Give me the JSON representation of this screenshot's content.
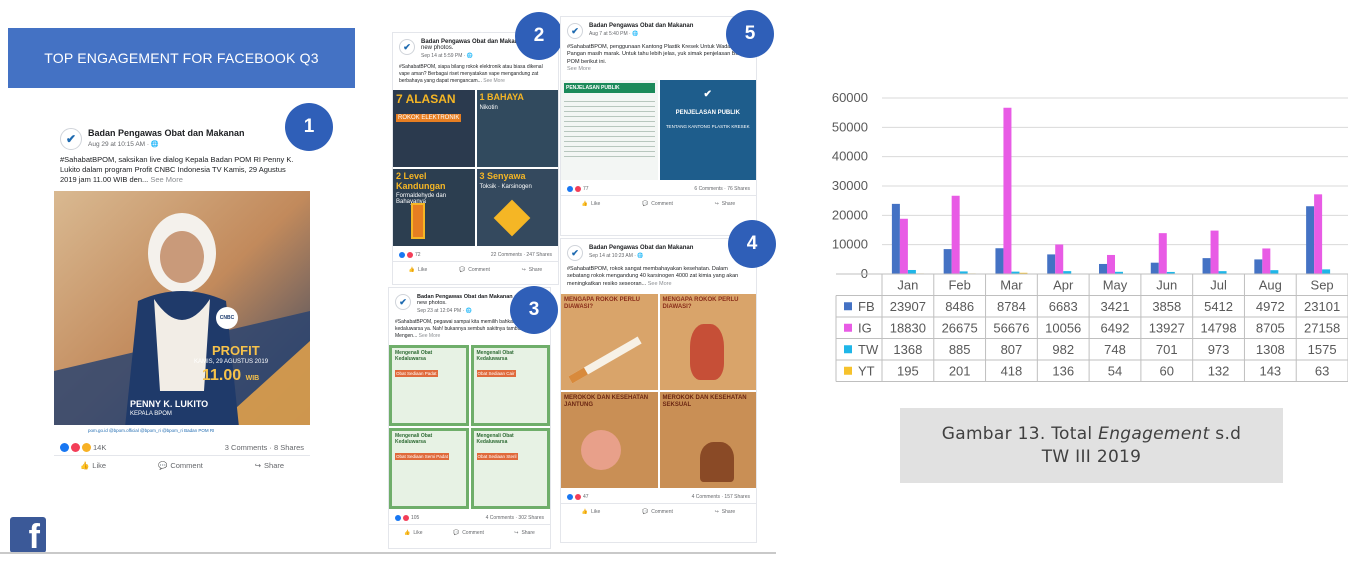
{
  "slide": {
    "title": "TOP ENGAGEMENT FOR FACEBOOK Q3",
    "badges": [
      "1",
      "2",
      "3",
      "4",
      "5"
    ],
    "logo_icon": "facebook-logo",
    "post1": {
      "page_name": "Badan Pengawas Obat dan Makanan",
      "time": "Aug 29 at 10:15 AM · ",
      "body": "#SahabatBPOM, saksikan live dialog Kepala Badan POM RI Penny K. Lukito dalam program Profit CNBC Indonesia TV Kamis, 29 Agustus 2019 jam 11.00 WIB den... ",
      "see_more": "See More",
      "image_title": "PROFIT",
      "image_date": "KAMIS, 29 AGUSTUS 2019",
      "image_time": "11.00",
      "image_time_suffix": "WIB",
      "image_name": "PENNY K. LUKITO",
      "image_role": "KEPALA BPOM",
      "image_channel": "CNBC",
      "image_footer": "pom.go.id   @bpom.official   @bpom_ri   @bpom_ri   Badan POM RI",
      "reaction_count": "14K",
      "stats": "3 Comments · 8 Shares",
      "actions": [
        "Like",
        "Comment",
        "Share"
      ]
    },
    "post2": {
      "page_name": "Badan Pengawas Obat dan Makanan",
      "page_suffix": "added 4 new photos.",
      "time": "Sep 14 at 5:59 PM · ",
      "body": "#SahabatBPOM, siapa bilang rokok elektronik atau biasa dikenal vape aman? Berbagai riset menyatakan vape mengandung zat berbahaya yang dapat mengancam... ",
      "see_more": "See More",
      "tiles": [
        {
          "title": "7 ALASAN",
          "sub": "ROKOK ELEKTRONIK"
        },
        {
          "title": "1 BAHAYA",
          "sub": "Nikotin"
        },
        {
          "title": "2 Level Kandungan",
          "sub": "Formaldehyde dan Bahayanya"
        },
        {
          "title": "3 Senyawa",
          "sub": "Toksik · Karsinogen"
        }
      ],
      "reaction_count": "72",
      "stats": "22 Comments · 247 Shares",
      "actions": [
        "Like",
        "Comment",
        "Share"
      ]
    },
    "post3": {
      "page_name": "Badan Pengawas Obat dan Makanan",
      "page_suffix": "added 4 new photos.",
      "time": "Sep 23 at 12:04 PM · ",
      "body": "#SahabatBPOM, pegawai sampai kita memilih bahkan obat kedaluwarsa ya. Nah! bukannya sembuh sakitnya tambah parah. ",
      "body_tail": "Mengen... ",
      "see_more": "See More",
      "tiles": [
        {
          "title": "Mengenali Obat Kedaluwarsa",
          "sub": "Obat Sediaan Padat"
        },
        {
          "title": "Mengenali Obat Kedaluwarsa",
          "sub": "Obat Sediaan Cair"
        },
        {
          "title": "Mengenali Obat Kedaluwarsa",
          "sub": "Obat Sediaan Semi Padat"
        },
        {
          "title": "Mengenali Obat Kedaluwarsa",
          "sub": "Obat Sediaan Steril"
        }
      ],
      "reaction_count": "105",
      "stats": "4 Comments · 302 Shares",
      "actions": [
        "Like",
        "Comment",
        "Share"
      ]
    },
    "post4": {
      "page_name": "Badan Pengawas Obat dan Makanan",
      "time": "Sep 14 at 10:23 AM · ",
      "body": "#SahabatBPOM, rokok sangat membahayakan kesehatan. Dalam sebatang rokok mengandung 40 karsinogen 4000 zat kimia yang akan meningkatkan resiko seseoran... ",
      "see_more": "See More",
      "tiles": [
        {
          "title": "MENGAPA ROKOK PERLU DIAWASI?",
          "sub": ""
        },
        {
          "title": "MENGAPA ROKOK PERLU DIAWASI?",
          "sub": ""
        },
        {
          "title": "MEROKOK DAN KESEHATAN JANTUNG",
          "sub": ""
        },
        {
          "title": "MEROKOK DAN KESEHATAN SEKSUAL",
          "sub": ""
        }
      ],
      "reaction_count": "47",
      "stats": "4 Comments · 157 Shares",
      "actions": [
        "Like",
        "Comment",
        "Share"
      ]
    },
    "post5": {
      "page_name": "Badan Pengawas Obat dan Makanan",
      "time": "Aug 7 at 5:40 PM · ",
      "body": "#SahabatBPOM, penggunaan Kantong Plastik Kresek Untuk Wadah Pangan masih marak. Untuk tahu lebih jelas, yuk simak penjelasan Badan POM berikut ini.",
      "see_more": "See More",
      "tiles": [
        {
          "title": "PENJELASAN PUBLIK",
          "sub": ""
        },
        {
          "title": "PENJELASAN PUBLIK",
          "sub": "TENTANG KANTONG PLASTIK KRESEK"
        }
      ],
      "reaction_count": "77",
      "stats": "6 Comments · 76 Shares",
      "actions": [
        "Like",
        "Comment",
        "Share"
      ]
    }
  },
  "chart_data": {
    "type": "bar",
    "categories": [
      "Jan",
      "Feb",
      "Mar",
      "Apr",
      "May",
      "Jun",
      "Jul",
      "Aug",
      "Sep"
    ],
    "series": [
      {
        "name": "FB",
        "values": [
          23907,
          8486,
          8784,
          6683,
          3421,
          3858,
          5412,
          4972,
          23101
        ],
        "color": "#4472c4"
      },
      {
        "name": "IG",
        "values": [
          18830,
          26675,
          56676,
          10056,
          6492,
          13927,
          14798,
          8705,
          27158
        ],
        "color": "#e85be5"
      },
      {
        "name": "TW",
        "values": [
          1368,
          885,
          807,
          982,
          748,
          701,
          973,
          1308,
          1575
        ],
        "color": "#1fb6e8"
      },
      {
        "name": "YT",
        "values": [
          195,
          201,
          418,
          136,
          54,
          60,
          132,
          143,
          63
        ],
        "color": "#f6c22c"
      }
    ],
    "yticks": [
      0,
      10000,
      20000,
      30000,
      40000,
      50000,
      60000
    ],
    "ylim": [
      0,
      60000
    ],
    "grid": true,
    "legend": "data-table"
  },
  "caption": {
    "prefix": "Gambar 13. Total ",
    "italic": "Engagement",
    "suffix": " s.d",
    "line2": "TW III 2019"
  }
}
